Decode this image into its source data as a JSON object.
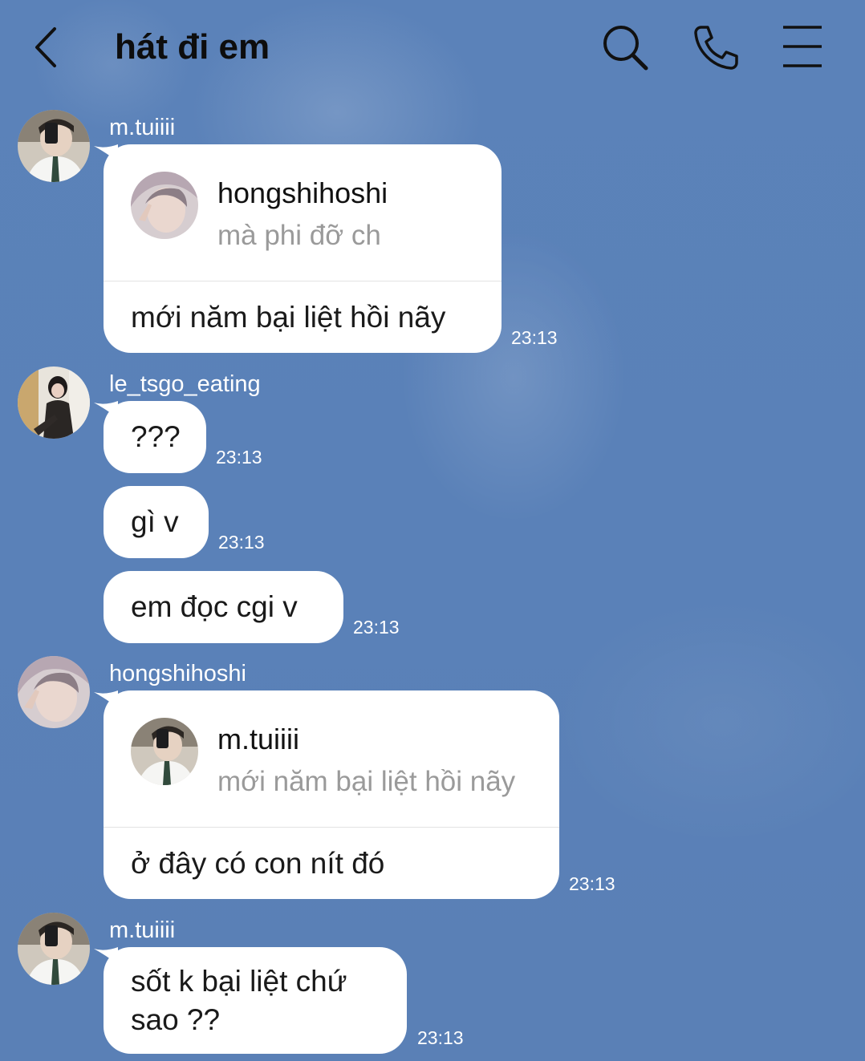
{
  "chat": {
    "title": "hát đi em"
  },
  "icons": {
    "back": "chevron-left-icon",
    "search": "search-icon",
    "call": "phone-icon",
    "menu": "menu-icon"
  },
  "messages": [
    {
      "sender": "m.tuiiii",
      "reply": {
        "name": "hongshihoshi",
        "preview": "mà phi đỡ ch"
      },
      "text": "mới năm bại liệt hồi nãy",
      "time": "23:13"
    },
    {
      "sender": "le_tsgo_eating",
      "text": "???",
      "time": "23:13"
    },
    {
      "text": "gì v",
      "time": "23:13"
    },
    {
      "text": "em đọc cgi v",
      "time": "23:13"
    },
    {
      "sender": "hongshihoshi",
      "reply": {
        "name": "m.tuiiii",
        "preview": "mới năm bại liệt hồi nãy"
      },
      "text": "ở đây có con nít đó",
      "time": "23:13"
    },
    {
      "sender": "m.tuiiii",
      "text": "sốt k bại liệt chứ sao ??",
      "time": "23:13"
    }
  ],
  "colors": {
    "background": "#5b82b8",
    "bubble": "#ffffff",
    "text": "#1a1a1a",
    "preview": "#9a9a9a"
  }
}
